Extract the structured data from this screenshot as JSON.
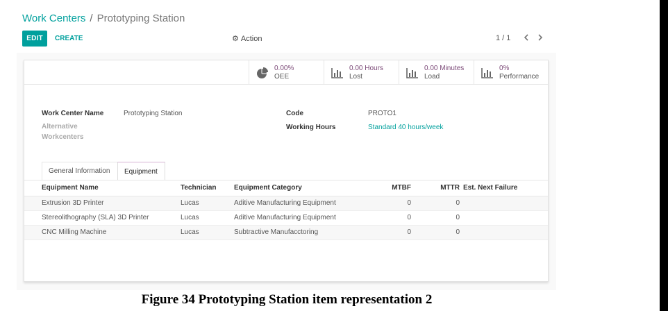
{
  "breadcrumb": {
    "parent": "Work Centers",
    "separator": "/",
    "current": "Prototyping Station"
  },
  "toolbar": {
    "edit_label": "EDIT",
    "create_label": "CREATE",
    "action_label": "Action",
    "action_icon": "gear-icon"
  },
  "pager": {
    "value": "1 / 1",
    "prev_icon": "chevron-left-icon",
    "next_icon": "chevron-right-icon"
  },
  "stats": [
    {
      "value": "0.00%",
      "label": "OEE",
      "icon": "pie-chart-icon"
    },
    {
      "value": "0.00 Hours",
      "label": "Lost",
      "icon": "bar-chart-icon"
    },
    {
      "value": "0.00 Minutes",
      "label": "Load",
      "icon": "bar-chart-icon"
    },
    {
      "value": "0%",
      "label": "Performance",
      "icon": "bar-chart-icon"
    }
  ],
  "form": {
    "name_label": "Work Center Name",
    "name_value": "Prototyping Station",
    "alt_label_line1": "Alternative",
    "alt_label_line2": "Workcenters",
    "code_label": "Code",
    "code_value": "PROTO1",
    "hours_label": "Working Hours",
    "hours_value": "Standard 40 hours/week"
  },
  "tabs": [
    {
      "label": "General Information",
      "active": false
    },
    {
      "label": "Equipment",
      "active": true
    }
  ],
  "table": {
    "headers": [
      "Equipment Name",
      "Technician",
      "Equipment Category",
      "MTBF",
      "MTTR",
      "Est. Next Failure"
    ],
    "rows": [
      [
        "Extrusion 3D Printer",
        "Lucas",
        "Aditive Manufacturing Equipment",
        "0",
        "0",
        ""
      ],
      [
        "Stereolithography (SLA) 3D Printer",
        "Lucas",
        "Aditive Manufacturing Equipment",
        "0",
        "0",
        ""
      ],
      [
        "CNC Milling Machine",
        "Lucas",
        "Subtractive Manufacctoring",
        "0",
        "0",
        ""
      ]
    ]
  },
  "caption": "Figure 34 Prototyping Station item representation 2",
  "colors": {
    "accent": "#00a09d",
    "stat_value": "#7c4a78"
  }
}
